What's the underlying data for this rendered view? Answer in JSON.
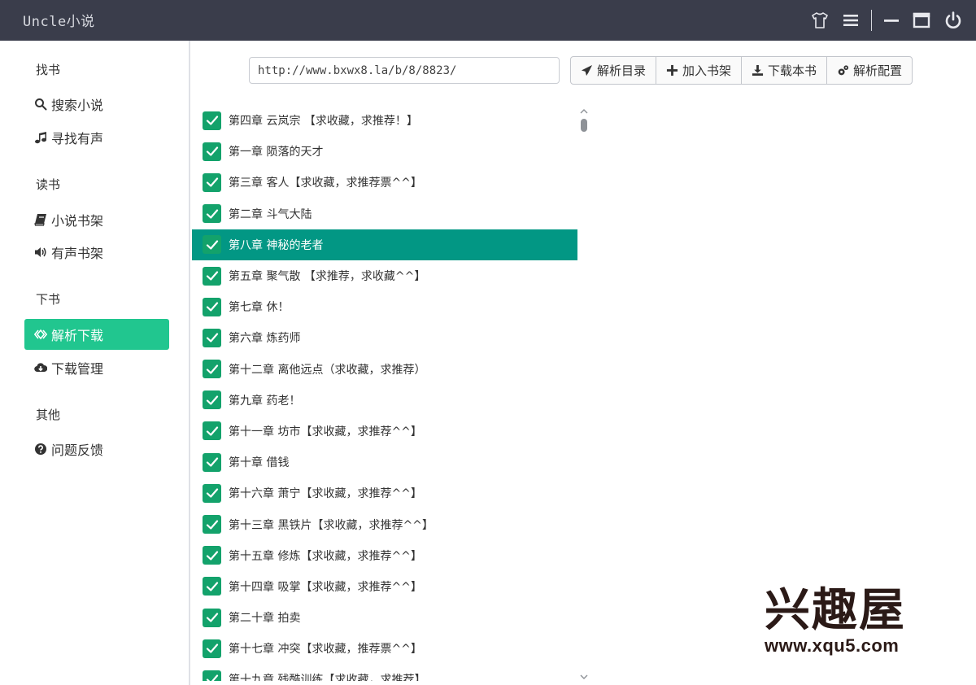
{
  "app": {
    "title": "Uncle小说"
  },
  "sidebar": {
    "sections": [
      {
        "label": "找书",
        "items": [
          {
            "label": "搜索小说",
            "icon": "search-icon"
          },
          {
            "label": "寻找有声",
            "icon": "music-icon"
          }
        ]
      },
      {
        "label": "读书",
        "items": [
          {
            "label": "小说书架",
            "icon": "book-icon"
          },
          {
            "label": "有声书架",
            "icon": "volume-icon"
          }
        ]
      },
      {
        "label": "下书",
        "items": [
          {
            "label": "解析下载",
            "icon": "code-icon",
            "active": true
          },
          {
            "label": "下载管理",
            "icon": "cloud-download-icon"
          }
        ]
      },
      {
        "label": "其他",
        "items": [
          {
            "label": "问题反馈",
            "icon": "question-icon"
          }
        ]
      }
    ]
  },
  "url_input": {
    "value": "http://www.bxwx8.la/b/8/8823/"
  },
  "toolbar": {
    "parse_catalog": "解析目录",
    "add_shelf": "加入书架",
    "download_book": "下载本书",
    "parse_config": "解析配置"
  },
  "chapters": [
    {
      "title": "第四章  云岚宗 【求收藏，求推荐！】",
      "checked": true
    },
    {
      "title": "第一章  陨落的天才",
      "checked": true
    },
    {
      "title": "第三章  客人【求收藏，求推荐票^^】",
      "checked": true
    },
    {
      "title": "第二章  斗气大陆",
      "checked": true
    },
    {
      "title": "第八章  神秘的老者",
      "checked": true,
      "selected": true
    },
    {
      "title": "第五章  聚气散 【求推荐，求收藏^^】",
      "checked": true
    },
    {
      "title": "第七章  休！",
      "checked": true
    },
    {
      "title": "第六章  炼药师",
      "checked": true
    },
    {
      "title": "第十二章  离他远点（求收藏，求推荐）",
      "checked": true
    },
    {
      "title": "第九章  药老！",
      "checked": true
    },
    {
      "title": "第十一章  坊市【求收藏，求推荐^^】",
      "checked": true
    },
    {
      "title": "第十章  借钱",
      "checked": true
    },
    {
      "title": "第十六章  萧宁【求收藏，求推荐^^】",
      "checked": true
    },
    {
      "title": "第十三章  黑铁片【求收藏，求推荐^^】",
      "checked": true
    },
    {
      "title": "第十五章  修炼【求收藏，求推荐^^】",
      "checked": true
    },
    {
      "title": "第十四章  吸掌【求收藏，求推荐^^】",
      "checked": true
    },
    {
      "title": "第二十章  拍卖",
      "checked": true
    },
    {
      "title": "第十七章  冲突【求收藏，推荐票^^】",
      "checked": true
    },
    {
      "title": "第十九章  残酷训练【求收藏，求推荐】",
      "checked": true
    }
  ],
  "watermark": {
    "text": "兴趣屋",
    "url": "www.xqu5.com"
  },
  "colors": {
    "titlebar": "#3a3d4b",
    "accent": "#21c68f",
    "selected_row": "#029784",
    "checkbox": "#13a26b"
  }
}
